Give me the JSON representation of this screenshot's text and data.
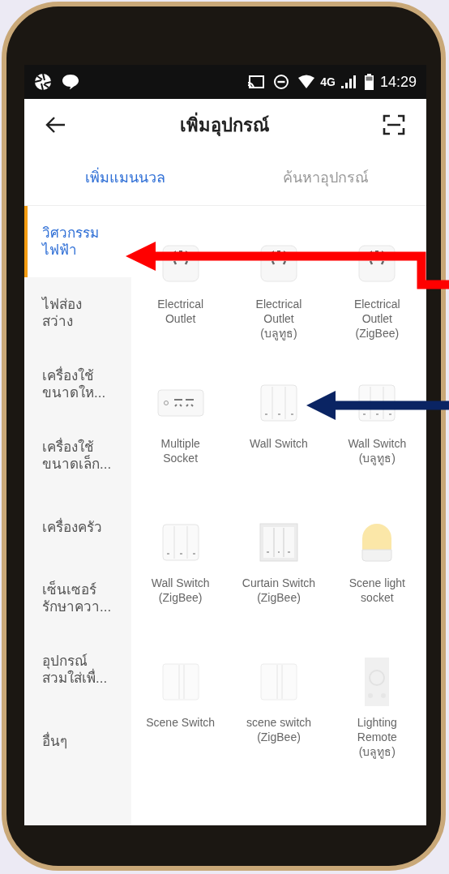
{
  "status_bar": {
    "network": "4G",
    "time": "14:29"
  },
  "header": {
    "title": "เพิ่มอุปกรณ์"
  },
  "tabs": [
    {
      "label": "เพิ่มแมนนวล",
      "selected": true
    },
    {
      "label": "ค้นหาอุปกรณ์",
      "selected": false
    }
  ],
  "sidebar": {
    "items": [
      {
        "label": "วิศวกรรม\nไฟฟ้า",
        "selected": true
      },
      {
        "label": "ไฟส่อง\nสว่าง",
        "selected": false
      },
      {
        "label": "เครื่องใช้\nขนาดให...",
        "selected": false
      },
      {
        "label": "เครื่องใช้\nขนาดเล็ก...",
        "selected": false
      },
      {
        "label": "เครื่องครัว",
        "selected": false
      },
      {
        "label": "เซ็นเซอร์\nรักษาควา...",
        "selected": false
      },
      {
        "label": "อุปกรณ์\nสวมใส่เพื่...",
        "selected": false
      },
      {
        "label": "อื่นๆ",
        "selected": false
      }
    ]
  },
  "devices": [
    {
      "label": "Electrical\nOutlet",
      "kind": "outlet"
    },
    {
      "label": "Electrical\nOutlet\n(บลูทูธ)",
      "kind": "outlet"
    },
    {
      "label": "Electrical\nOutlet\n(ZigBee)",
      "kind": "outlet"
    },
    {
      "label": "Multiple\nSocket",
      "kind": "strip"
    },
    {
      "label": "Wall Switch",
      "kind": "switch"
    },
    {
      "label": "Wall Switch\n(บลูทูธ)",
      "kind": "switch"
    },
    {
      "label": "Wall Switch\n(ZigBee)",
      "kind": "switch"
    },
    {
      "label": "Curtain Switch\n(ZigBee)",
      "kind": "curtain"
    },
    {
      "label": "Scene light\nsocket",
      "kind": "lamp"
    },
    {
      "label": "Scene Switch",
      "kind": "scene"
    },
    {
      "label": "scene switch\n(ZigBee)",
      "kind": "scene"
    },
    {
      "label": "Lighting\nRemote\n(บลูทูธ)",
      "kind": "remote"
    }
  ]
}
